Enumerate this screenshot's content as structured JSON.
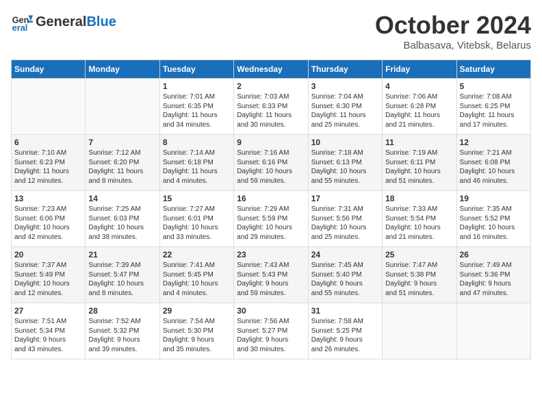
{
  "header": {
    "logo_line1": "General",
    "logo_line2": "Blue",
    "month": "October 2024",
    "location": "Balbasava, Vitebsk, Belarus"
  },
  "days_of_week": [
    "Sunday",
    "Monday",
    "Tuesday",
    "Wednesday",
    "Thursday",
    "Friday",
    "Saturday"
  ],
  "weeks": [
    [
      {
        "day": "",
        "content": ""
      },
      {
        "day": "",
        "content": ""
      },
      {
        "day": "1",
        "content": "Sunrise: 7:01 AM\nSunset: 6:35 PM\nDaylight: 11 hours\nand 34 minutes."
      },
      {
        "day": "2",
        "content": "Sunrise: 7:03 AM\nSunset: 6:33 PM\nDaylight: 11 hours\nand 30 minutes."
      },
      {
        "day": "3",
        "content": "Sunrise: 7:04 AM\nSunset: 6:30 PM\nDaylight: 11 hours\nand 25 minutes."
      },
      {
        "day": "4",
        "content": "Sunrise: 7:06 AM\nSunset: 6:28 PM\nDaylight: 11 hours\nand 21 minutes."
      },
      {
        "day": "5",
        "content": "Sunrise: 7:08 AM\nSunset: 6:25 PM\nDaylight: 11 hours\nand 17 minutes."
      }
    ],
    [
      {
        "day": "6",
        "content": "Sunrise: 7:10 AM\nSunset: 6:23 PM\nDaylight: 11 hours\nand 12 minutes."
      },
      {
        "day": "7",
        "content": "Sunrise: 7:12 AM\nSunset: 6:20 PM\nDaylight: 11 hours\nand 8 minutes."
      },
      {
        "day": "8",
        "content": "Sunrise: 7:14 AM\nSunset: 6:18 PM\nDaylight: 11 hours\nand 4 minutes."
      },
      {
        "day": "9",
        "content": "Sunrise: 7:16 AM\nSunset: 6:16 PM\nDaylight: 10 hours\nand 59 minutes."
      },
      {
        "day": "10",
        "content": "Sunrise: 7:18 AM\nSunset: 6:13 PM\nDaylight: 10 hours\nand 55 minutes."
      },
      {
        "day": "11",
        "content": "Sunrise: 7:19 AM\nSunset: 6:11 PM\nDaylight: 10 hours\nand 51 minutes."
      },
      {
        "day": "12",
        "content": "Sunrise: 7:21 AM\nSunset: 6:08 PM\nDaylight: 10 hours\nand 46 minutes."
      }
    ],
    [
      {
        "day": "13",
        "content": "Sunrise: 7:23 AM\nSunset: 6:06 PM\nDaylight: 10 hours\nand 42 minutes."
      },
      {
        "day": "14",
        "content": "Sunrise: 7:25 AM\nSunset: 6:03 PM\nDaylight: 10 hours\nand 38 minutes."
      },
      {
        "day": "15",
        "content": "Sunrise: 7:27 AM\nSunset: 6:01 PM\nDaylight: 10 hours\nand 33 minutes."
      },
      {
        "day": "16",
        "content": "Sunrise: 7:29 AM\nSunset: 5:59 PM\nDaylight: 10 hours\nand 29 minutes."
      },
      {
        "day": "17",
        "content": "Sunrise: 7:31 AM\nSunset: 5:56 PM\nDaylight: 10 hours\nand 25 minutes."
      },
      {
        "day": "18",
        "content": "Sunrise: 7:33 AM\nSunset: 5:54 PM\nDaylight: 10 hours\nand 21 minutes."
      },
      {
        "day": "19",
        "content": "Sunrise: 7:35 AM\nSunset: 5:52 PM\nDaylight: 10 hours\nand 16 minutes."
      }
    ],
    [
      {
        "day": "20",
        "content": "Sunrise: 7:37 AM\nSunset: 5:49 PM\nDaylight: 10 hours\nand 12 minutes."
      },
      {
        "day": "21",
        "content": "Sunrise: 7:39 AM\nSunset: 5:47 PM\nDaylight: 10 hours\nand 8 minutes."
      },
      {
        "day": "22",
        "content": "Sunrise: 7:41 AM\nSunset: 5:45 PM\nDaylight: 10 hours\nand 4 minutes."
      },
      {
        "day": "23",
        "content": "Sunrise: 7:43 AM\nSunset: 5:43 PM\nDaylight: 9 hours\nand 59 minutes."
      },
      {
        "day": "24",
        "content": "Sunrise: 7:45 AM\nSunset: 5:40 PM\nDaylight: 9 hours\nand 55 minutes."
      },
      {
        "day": "25",
        "content": "Sunrise: 7:47 AM\nSunset: 5:38 PM\nDaylight: 9 hours\nand 51 minutes."
      },
      {
        "day": "26",
        "content": "Sunrise: 7:49 AM\nSunset: 5:36 PM\nDaylight: 9 hours\nand 47 minutes."
      }
    ],
    [
      {
        "day": "27",
        "content": "Sunrise: 7:51 AM\nSunset: 5:34 PM\nDaylight: 9 hours\nand 43 minutes."
      },
      {
        "day": "28",
        "content": "Sunrise: 7:52 AM\nSunset: 5:32 PM\nDaylight: 9 hours\nand 39 minutes."
      },
      {
        "day": "29",
        "content": "Sunrise: 7:54 AM\nSunset: 5:30 PM\nDaylight: 9 hours\nand 35 minutes."
      },
      {
        "day": "30",
        "content": "Sunrise: 7:56 AM\nSunset: 5:27 PM\nDaylight: 9 hours\nand 30 minutes."
      },
      {
        "day": "31",
        "content": "Sunrise: 7:58 AM\nSunset: 5:25 PM\nDaylight: 9 hours\nand 26 minutes."
      },
      {
        "day": "",
        "content": ""
      },
      {
        "day": "",
        "content": ""
      }
    ]
  ]
}
